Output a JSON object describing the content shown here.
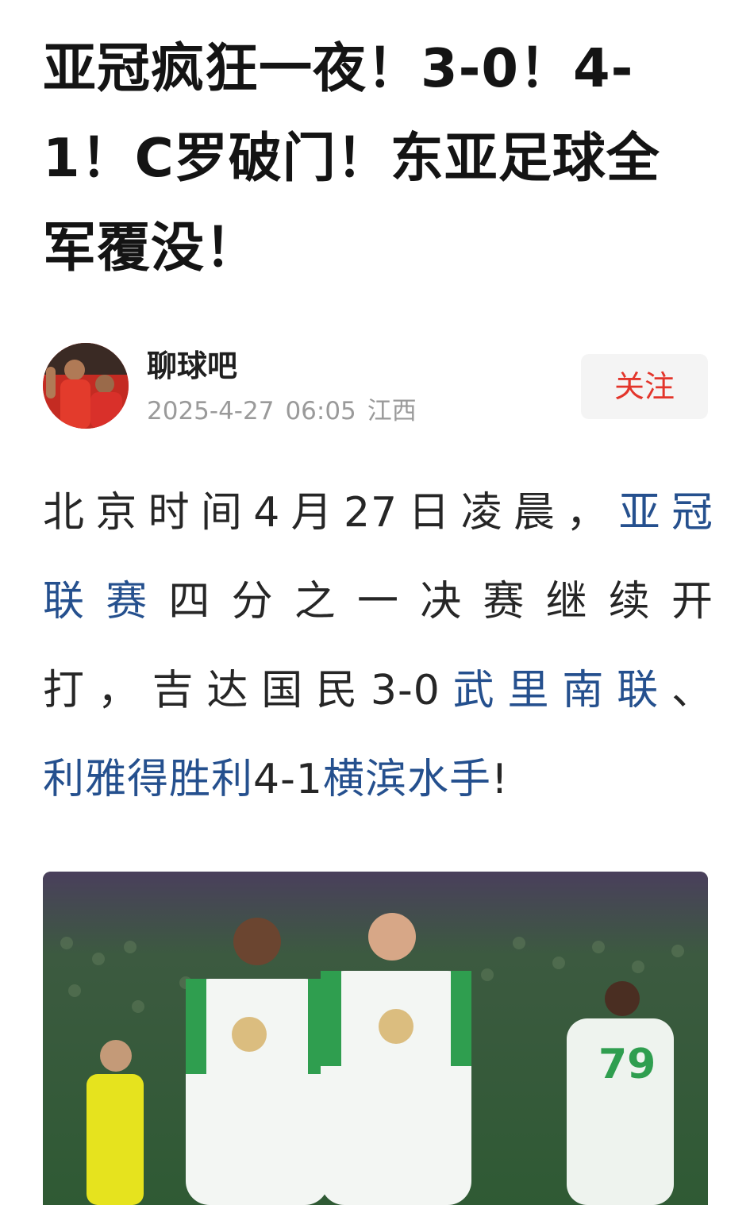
{
  "article": {
    "title": "亚冠疯狂一夜！3-0！4-1！C罗破门！东亚足球全军覆没！"
  },
  "author": {
    "name": "聊球吧",
    "date": "2025-4-27",
    "time": "06:05",
    "location": "江西",
    "follow_label": "关注"
  },
  "content": {
    "line1_text": "北京时间4月27日凌晨，",
    "link1": "亚冠",
    "link1_cont": "联赛",
    "line2_text": "四分之一决赛继续开",
    "line3_text": "打，吉达国民3-0",
    "link2": "武里南联",
    "sep": "、",
    "link3": "利雅得胜利",
    "score2": "4-1",
    "link4": "横滨水手",
    "end": "!"
  },
  "photo": {
    "jersey_number": "79"
  },
  "colors": {
    "link": "#25508e",
    "follow": "#e3352b"
  }
}
